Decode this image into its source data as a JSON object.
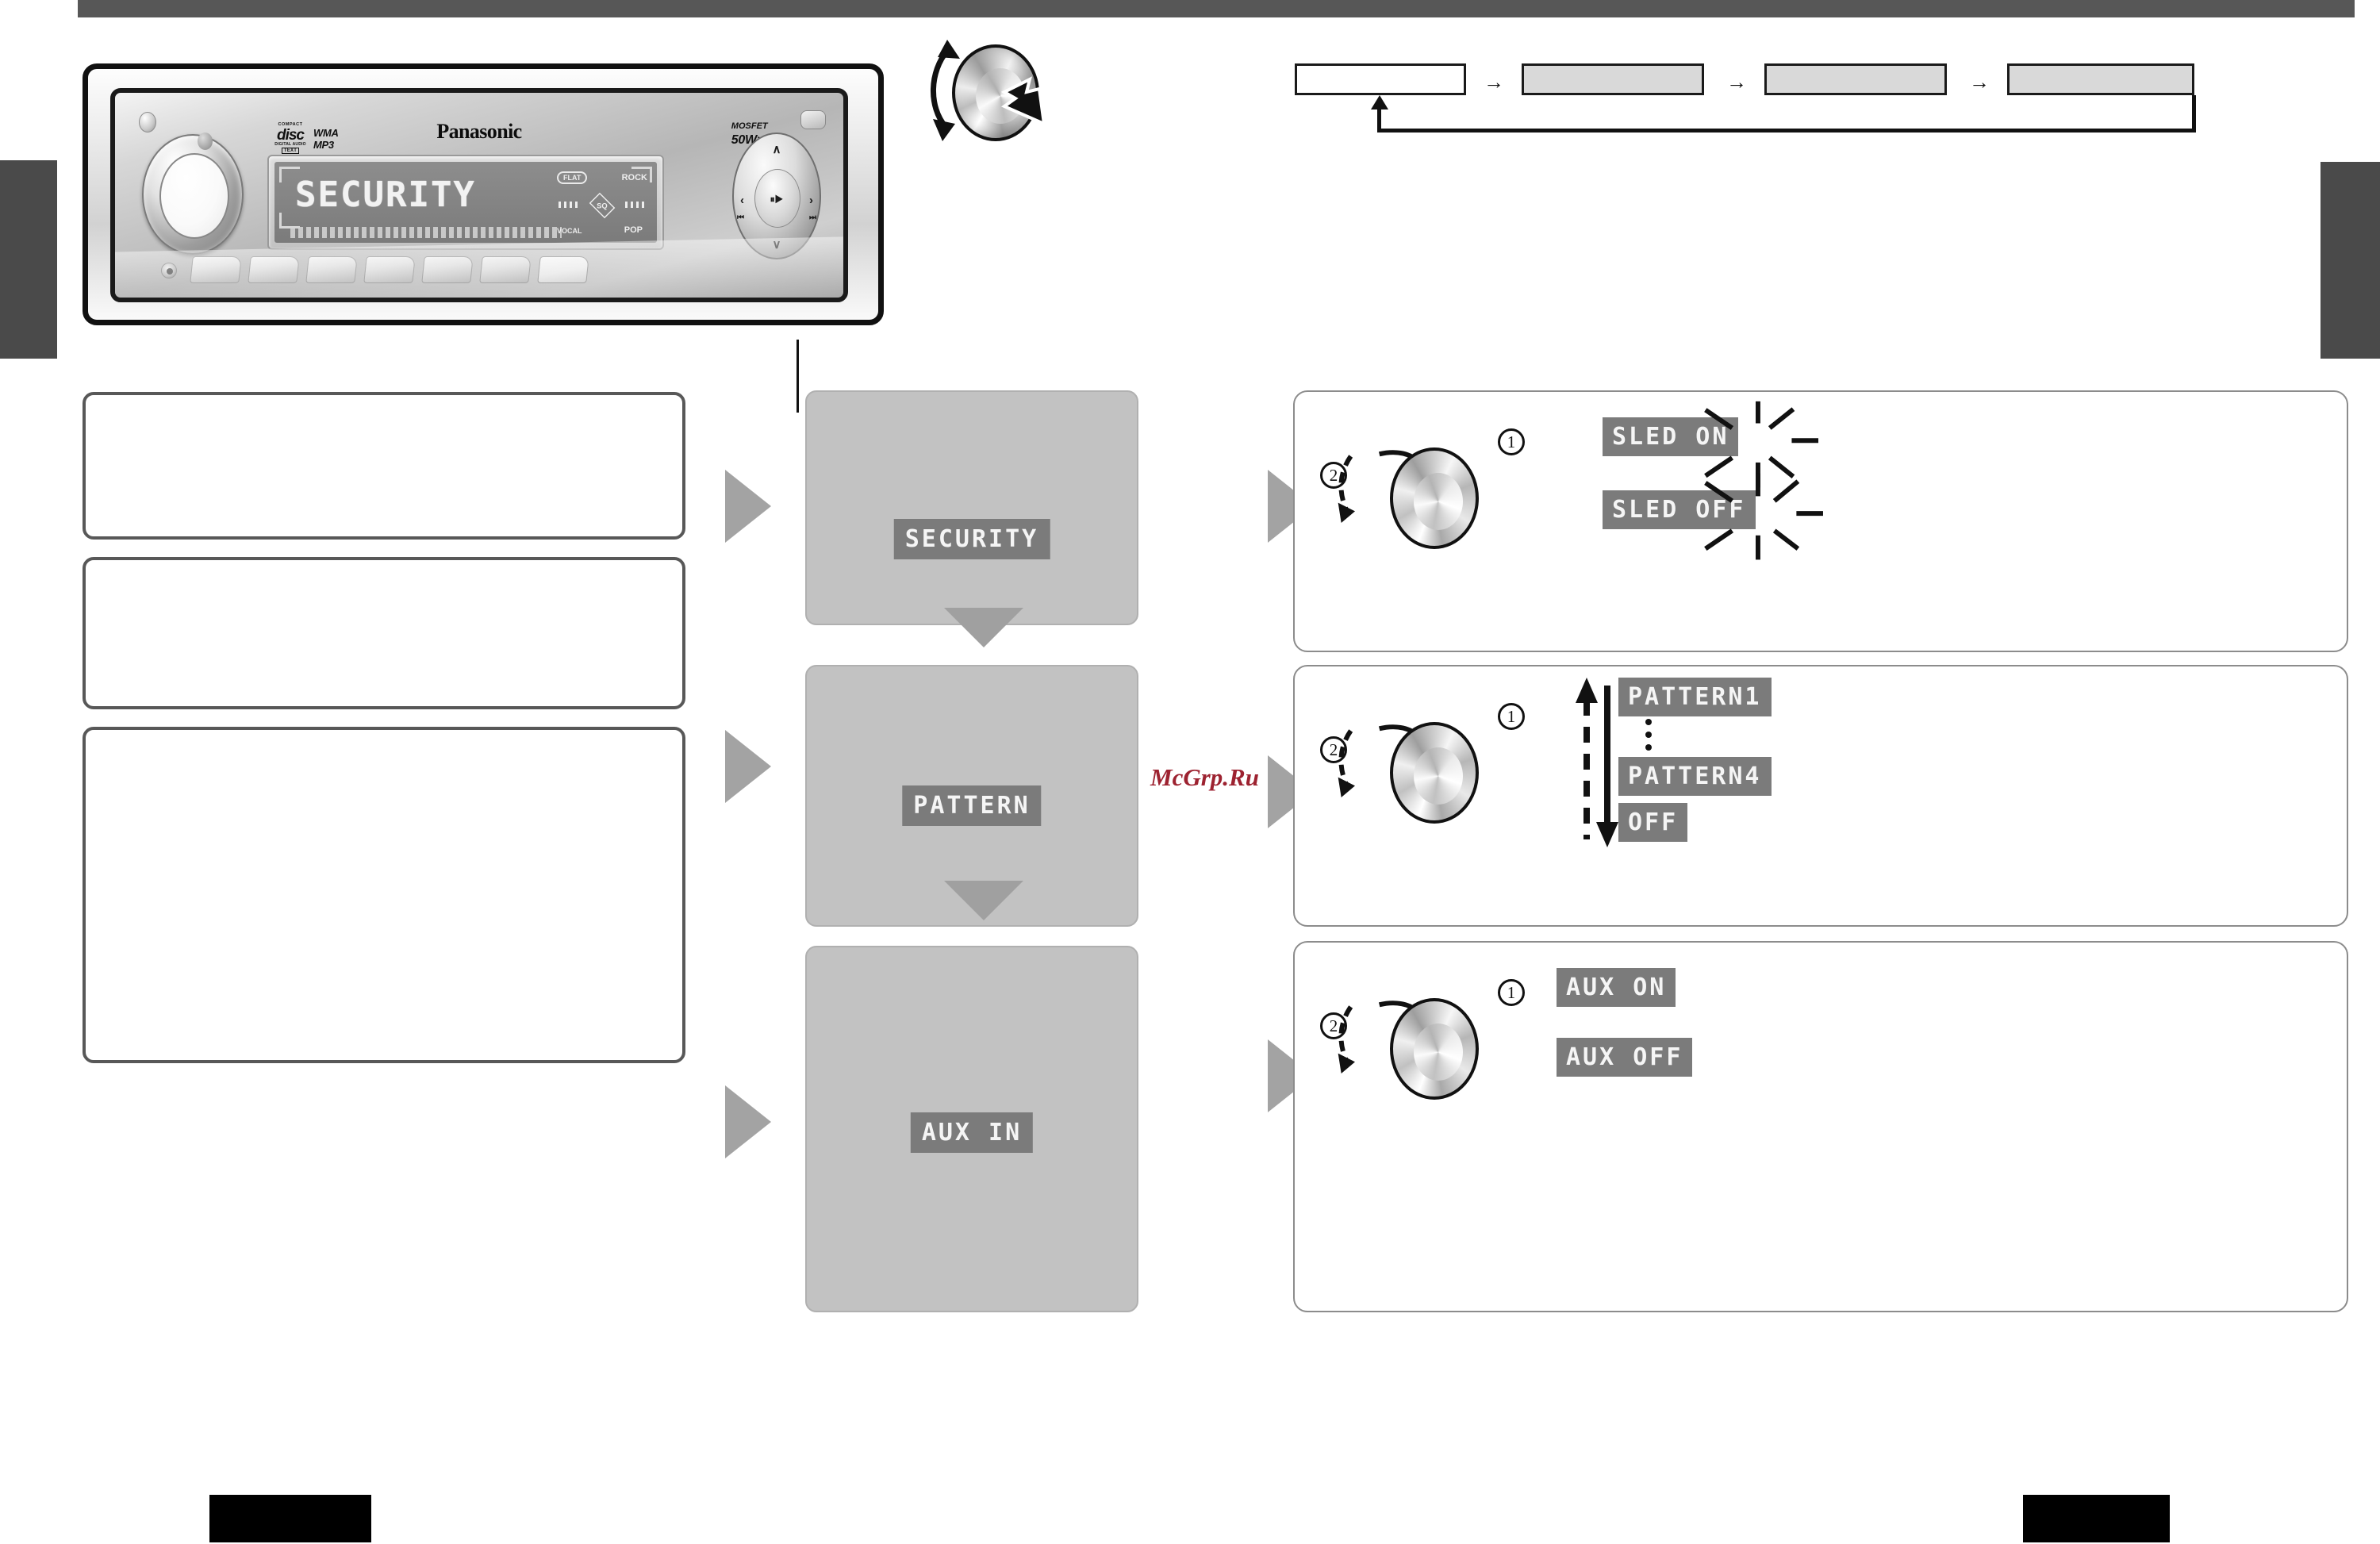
{
  "device": {
    "brand": "Panasonic",
    "power_label_small": "MOSFET",
    "power_label_big": "50Wx4",
    "disc_logo": {
      "top": "COMPACT",
      "mid": "disc",
      "bottom": "DIGITAL AUDIO",
      "text_badge": "TEXT"
    },
    "codec_wma": "WMA",
    "codec_mp3": "MP3",
    "lcd_text": "SECURITY",
    "eq_flat": "FLAT",
    "eq_rock": "ROCK",
    "eq_sq": "SQ",
    "eq_vocal": "VOCAL",
    "eq_pop": "POP",
    "dpad": {
      "up": "∧",
      "down": "∨",
      "left": "‹",
      "right": "›",
      "prev": "⏮",
      "next": "⏭",
      "play": "⏸▶"
    }
  },
  "flow_chain": {
    "arrow": "→",
    "steps": [
      {
        "label": "",
        "style": "blank"
      },
      {
        "label": "",
        "style": "filled"
      },
      {
        "label": "",
        "style": "filled"
      },
      {
        "label": "",
        "style": "filled"
      }
    ]
  },
  "rows": [
    {
      "id": "security",
      "description": "",
      "menu_display": "SECURITY",
      "step_numbers": {
        "first": "1",
        "second": "2"
      },
      "results": [
        {
          "display": "SLED ON",
          "blinking": true
        },
        {
          "display": "SLED OFF",
          "blinking": true
        }
      ],
      "note_bar": ""
    },
    {
      "id": "pattern",
      "description": "",
      "menu_display": "PATTERN",
      "step_numbers": {
        "first": "1",
        "second": "2"
      },
      "results": [
        {
          "display": "PATTERN1",
          "blinking": false
        },
        {
          "display": "PATTERN4",
          "blinking": false
        },
        {
          "display": "OFF",
          "blinking": false
        }
      ],
      "ellipsis_dots": 5
    },
    {
      "id": "aux-in",
      "description": "",
      "menu_display": "AUX IN",
      "step_numbers": {
        "first": "1",
        "second": "2"
      },
      "results": [
        {
          "display": "AUX ON",
          "blinking": false
        },
        {
          "display": "AUX OFF",
          "blinking": false
        }
      ]
    }
  ],
  "watermark": "McGrp.Ru",
  "colors": {
    "lcd_background": "#7b7b7b",
    "lcd_text": "#f5f5f5",
    "panel_gray": "#c2c2c2",
    "chevron_gray": "#a3a3a3",
    "tab_gray": "#4a4a4a",
    "header_gray": "#575757",
    "watermark_red": "#9d2230",
    "redaction_black": "#000000"
  }
}
